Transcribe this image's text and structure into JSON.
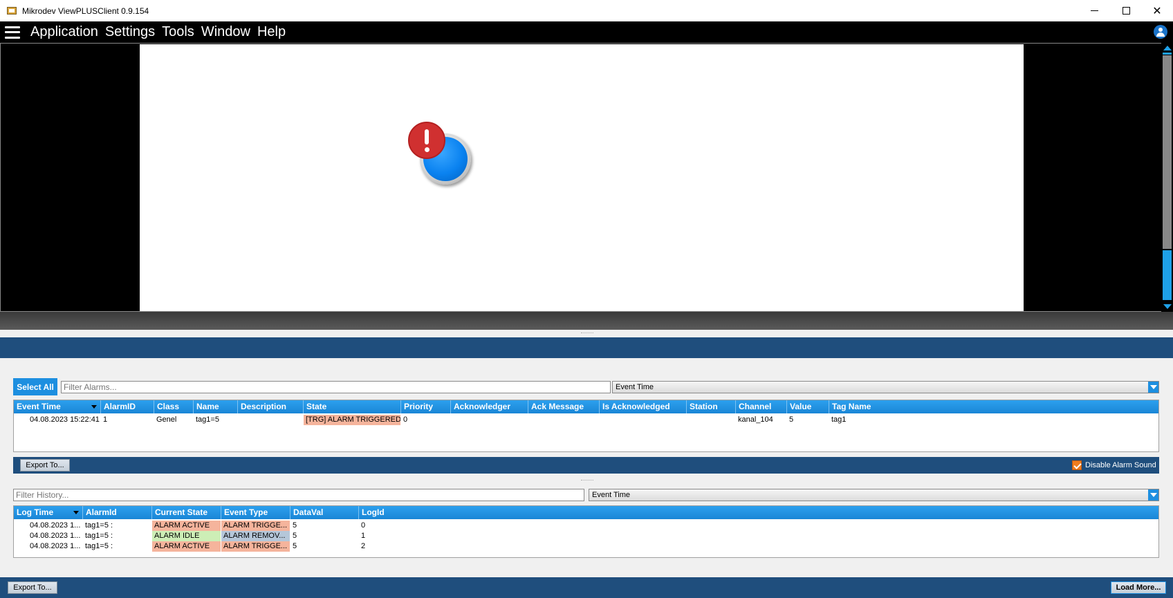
{
  "window": {
    "title": "Mikrodev ViewPLUSClient 0.9.154"
  },
  "menu": {
    "items": [
      "Application",
      "Settings",
      "Tools",
      "Window",
      "Help"
    ]
  },
  "alarms": {
    "select_all_label": "Select All",
    "filter_placeholder": "Filter Alarms...",
    "sort_select_value": "Event Time",
    "columns": [
      "Event Time",
      "AlarmID",
      "Class",
      "Name",
      "Description",
      "State",
      "Priority",
      "Acknowledger",
      "Ack Message",
      "Is Acknowledged",
      "Station",
      "Channel",
      "Value",
      "Tag Name"
    ],
    "rows": [
      {
        "event_time": "04.08.2023 15:22:41",
        "alarm_id": "1",
        "class": "Genel",
        "name": "tag1=5",
        "description": "",
        "state": "[TRG] ALARM TRIGGERED",
        "priority": "0",
        "acknowledger": "",
        "ack_message": "",
        "is_acknowledged": "",
        "station": "",
        "channel": "kanal_104",
        "value": "5",
        "tag_name": "tag1"
      }
    ],
    "export_label": "Export To...",
    "disable_sound_label": "Disable Alarm Sound",
    "disable_sound_checked": true
  },
  "history": {
    "filter_placeholder": "Filter History...",
    "sort_select_value": "Event Time",
    "columns": [
      "Log Time",
      "AlarmId",
      "Current State",
      "Event Type",
      "DataVal",
      "LogId"
    ],
    "rows": [
      {
        "log_time": "04.08.2023 1...",
        "alarm_id": "tag1=5 :",
        "current_state": "ALARM ACTIVE",
        "event_type": "ALARM TRIGGE...",
        "data_val": "5",
        "log_id": "0"
      },
      {
        "log_time": "04.08.2023 1...",
        "alarm_id": "tag1=5 :",
        "current_state": "ALARM IDLE",
        "event_type": "ALARM REMOV...",
        "data_val": "5",
        "log_id": "1"
      },
      {
        "log_time": "04.08.2023 1...",
        "alarm_id": "tag1=5 :",
        "current_state": "ALARM ACTIVE",
        "event_type": "ALARM TRIGGE...",
        "data_val": "5",
        "log_id": "2"
      }
    ],
    "export_label": "Export To...",
    "load_more_label": "Load More..."
  },
  "colors": {
    "accent": "#1d8fe0",
    "panel_header": "#1f4e7d",
    "alarm_badge": "#d03030",
    "button_blue": "#0a82f0"
  },
  "icons": {
    "alarm": "exclamation-badge-icon",
    "user": "user-icon",
    "menu": "hamburger-icon"
  }
}
